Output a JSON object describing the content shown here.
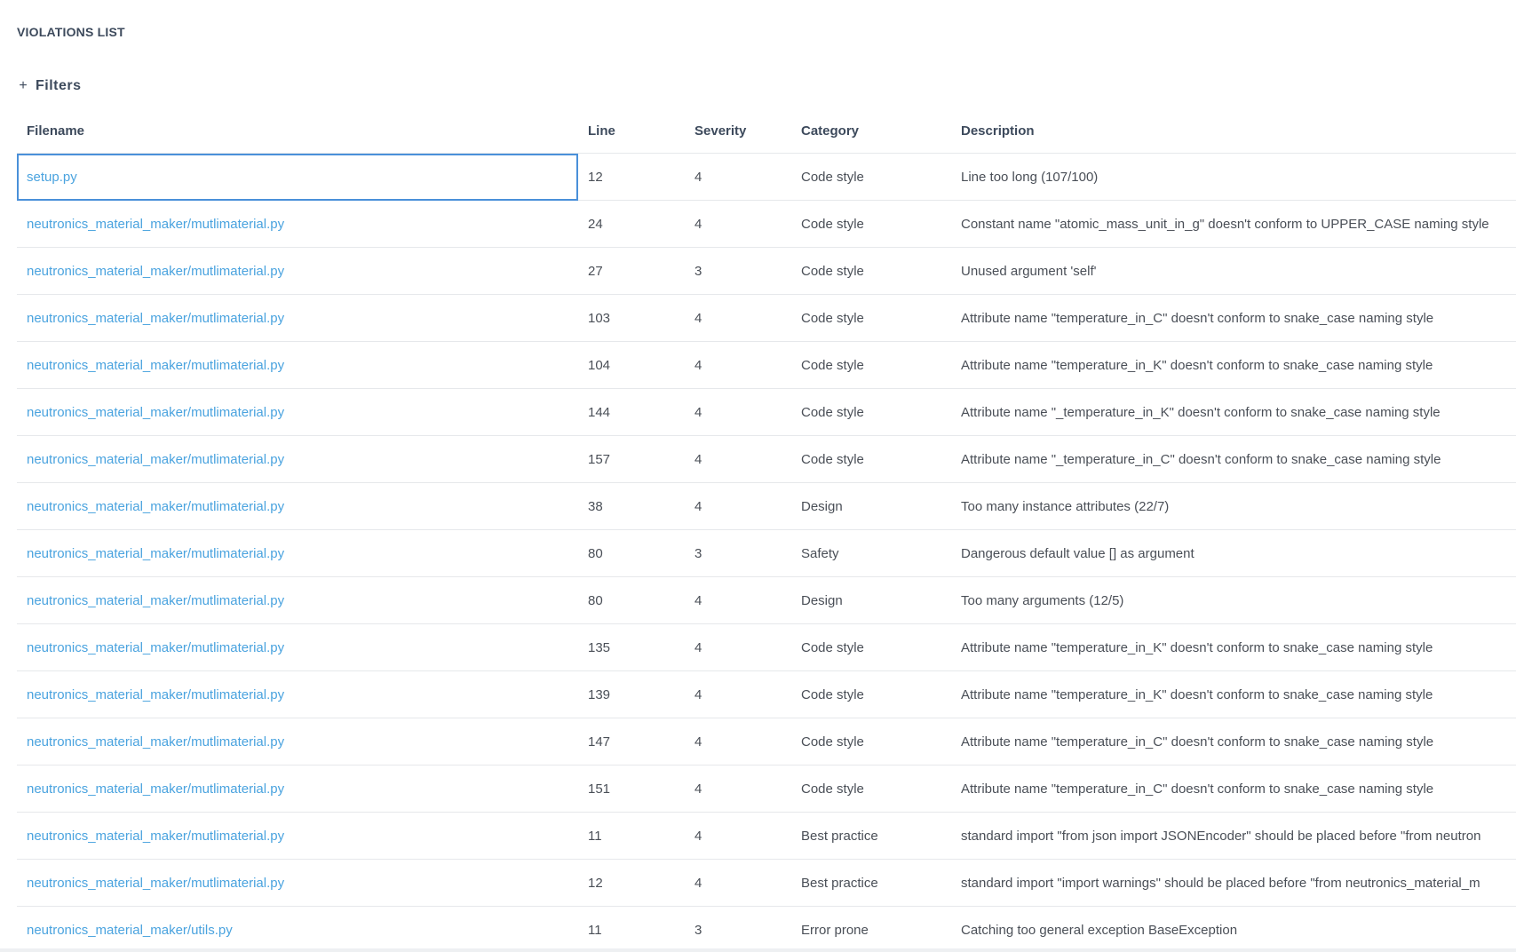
{
  "section": {
    "title": "VIOLATIONS LIST"
  },
  "filters": {
    "toggle_icon": "plus-icon",
    "label": "Filters"
  },
  "table": {
    "headers": {
      "filename": "Filename",
      "line": "Line",
      "severity": "Severity",
      "category": "Category",
      "description": "Description"
    },
    "rows": [
      {
        "filename": "setup.py",
        "line": "12",
        "severity": "4",
        "category": "Code style",
        "description": "Line too long (107/100)"
      },
      {
        "filename": "neutronics_material_maker/mutlimaterial.py",
        "line": "24",
        "severity": "4",
        "category": "Code style",
        "description": "Constant name \"atomic_mass_unit_in_g\" doesn't conform to UPPER_CASE naming style"
      },
      {
        "filename": "neutronics_material_maker/mutlimaterial.py",
        "line": "27",
        "severity": "3",
        "category": "Code style",
        "description": "Unused argument 'self'"
      },
      {
        "filename": "neutronics_material_maker/mutlimaterial.py",
        "line": "103",
        "severity": "4",
        "category": "Code style",
        "description": "Attribute name \"temperature_in_C\" doesn't conform to snake_case naming style"
      },
      {
        "filename": "neutronics_material_maker/mutlimaterial.py",
        "line": "104",
        "severity": "4",
        "category": "Code style",
        "description": "Attribute name \"temperature_in_K\" doesn't conform to snake_case naming style"
      },
      {
        "filename": "neutronics_material_maker/mutlimaterial.py",
        "line": "144",
        "severity": "4",
        "category": "Code style",
        "description": "Attribute name \"_temperature_in_K\" doesn't conform to snake_case naming style"
      },
      {
        "filename": "neutronics_material_maker/mutlimaterial.py",
        "line": "157",
        "severity": "4",
        "category": "Code style",
        "description": "Attribute name \"_temperature_in_C\" doesn't conform to snake_case naming style"
      },
      {
        "filename": "neutronics_material_maker/mutlimaterial.py",
        "line": "38",
        "severity": "4",
        "category": "Design",
        "description": "Too many instance attributes (22/7)"
      },
      {
        "filename": "neutronics_material_maker/mutlimaterial.py",
        "line": "80",
        "severity": "3",
        "category": "Safety",
        "description": "Dangerous default value [] as argument"
      },
      {
        "filename": "neutronics_material_maker/mutlimaterial.py",
        "line": "80",
        "severity": "4",
        "category": "Design",
        "description": "Too many arguments (12/5)"
      },
      {
        "filename": "neutronics_material_maker/mutlimaterial.py",
        "line": "135",
        "severity": "4",
        "category": "Code style",
        "description": "Attribute name \"temperature_in_K\" doesn't conform to snake_case naming style"
      },
      {
        "filename": "neutronics_material_maker/mutlimaterial.py",
        "line": "139",
        "severity": "4",
        "category": "Code style",
        "description": "Attribute name \"temperature_in_K\" doesn't conform to snake_case naming style"
      },
      {
        "filename": "neutronics_material_maker/mutlimaterial.py",
        "line": "147",
        "severity": "4",
        "category": "Code style",
        "description": "Attribute name \"temperature_in_C\" doesn't conform to snake_case naming style"
      },
      {
        "filename": "neutronics_material_maker/mutlimaterial.py",
        "line": "151",
        "severity": "4",
        "category": "Code style",
        "description": "Attribute name \"temperature_in_C\" doesn't conform to snake_case naming style"
      },
      {
        "filename": "neutronics_material_maker/mutlimaterial.py",
        "line": "11",
        "severity": "4",
        "category": "Best practice",
        "description": "standard import \"from json import JSONEncoder\" should be placed before \"from neutron"
      },
      {
        "filename": "neutronics_material_maker/mutlimaterial.py",
        "line": "12",
        "severity": "4",
        "category": "Best practice",
        "description": "standard import \"import warnings\" should be placed before \"from neutronics_material_m"
      },
      {
        "filename": "neutronics_material_maker/utils.py",
        "line": "11",
        "severity": "3",
        "category": "Error prone",
        "description": "Catching too general exception BaseException"
      }
    ]
  },
  "colors": {
    "link": "#4aa3df",
    "text": "#4a4f57",
    "heading": "#3d4a5c",
    "selection_outline": "#4a90d9",
    "row_divider": "#e6e8eb"
  }
}
